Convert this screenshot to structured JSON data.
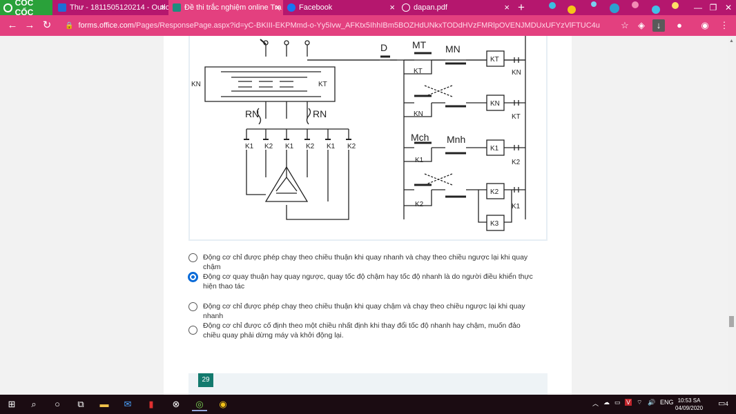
{
  "browser": {
    "brand": "CỐC CỐC",
    "tabs": [
      {
        "title": "Thư - 1811505120214 - Outlo",
        "icon": "outlook-icon",
        "color": "#1e6ed8"
      },
      {
        "title": "Đề thi trắc nghiệm online Trạ",
        "icon": "forms-icon",
        "color": "#1e8c7e"
      },
      {
        "title": "Facebook",
        "icon": "facebook-icon",
        "color": "#1877f2"
      },
      {
        "title": "dapan.pdf",
        "icon": "globe-icon",
        "color": "#ffffff"
      }
    ],
    "new_tab": "+",
    "url_host": "forms.office.com",
    "url_rest": "/Pages/ResponsePage.aspx?id=yC-BKIII-EKPMmd-o-Yy5Ivw_AFKtx5IhhIBm5BOZHdUNkxTODdHVzFMRlpOVENJMDUxUFYzVlFTUC4u"
  },
  "diagram": {
    "labels": {
      "D": "D",
      "MT": "MT",
      "MN": "MN",
      "KT": "KT",
      "KN": "KN",
      "RN": "RN",
      "Mch": "Mch",
      "Mnh": "Mnh",
      "K1": "K1",
      "K2": "K2",
      "K3": "K3"
    }
  },
  "question": {
    "options": [
      {
        "text": "Động cơ chỉ được phép chạy theo chiều thuận khi quay nhanh và chạy theo chiều ngược lại khi quay chậm",
        "selected": false
      },
      {
        "text": "Động cơ quay thuận hay quay ngược, quay tốc độ chậm hay tốc độ nhanh là do người điều khiển thực hiện thao tác",
        "selected": true
      },
      {
        "text": "Động cơ chỉ được phép chạy theo chiều thuận khi quay chậm và chạy theo chiều ngược lại khi quay nhanh",
        "selected": false
      },
      {
        "text": "Động cơ chỉ được cố định theo một chiều nhất định khi thay đổi tốc độ nhanh hay chậm, muốn đảo chiều quay phải dừng máy và khởi động lại.",
        "selected": false
      }
    ],
    "next_number": "29"
  },
  "taskbar": {
    "lang": "ENG",
    "time": "10:53 SA",
    "date": "04/09/2020",
    "notifications": "4"
  },
  "colors": {
    "tabbar": "#b5176e",
    "addressbar": "#e3407f",
    "brand": "#2aa13a",
    "selected_radio": "#0a6bd8",
    "question_badge": "#137a6e"
  }
}
